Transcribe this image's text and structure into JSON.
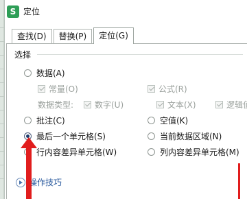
{
  "window": {
    "app_icon_letter": "S",
    "title": "定位"
  },
  "tabs": [
    {
      "label": "查找(D)",
      "active": false
    },
    {
      "label": "替换(P)",
      "active": false
    },
    {
      "label": "定位(G)",
      "active": true
    }
  ],
  "section": {
    "label": "选择"
  },
  "options": {
    "data": "数据(A)",
    "constants": "常量(O)",
    "formulas": "公式(R)",
    "data_type_label": "数据类型:",
    "numbers": "数字(U)",
    "text": "文本(X)",
    "logical": "逻辑值",
    "comments": "批注(C)",
    "blanks": "空值(K)",
    "last_cell": "最后一个单元格(S)",
    "current_region": "当前数据区域(N)",
    "row_differences": "行内容差异单元格(W)",
    "column_differences": "列内容差异单元格(M)"
  },
  "selected_option": "last_cell",
  "footer": {
    "tip_label": "操作技巧"
  },
  "colors": {
    "accent_red": "#e11d1d",
    "logo_green": "#2e9e57",
    "link_blue": "#2a5a9e"
  }
}
